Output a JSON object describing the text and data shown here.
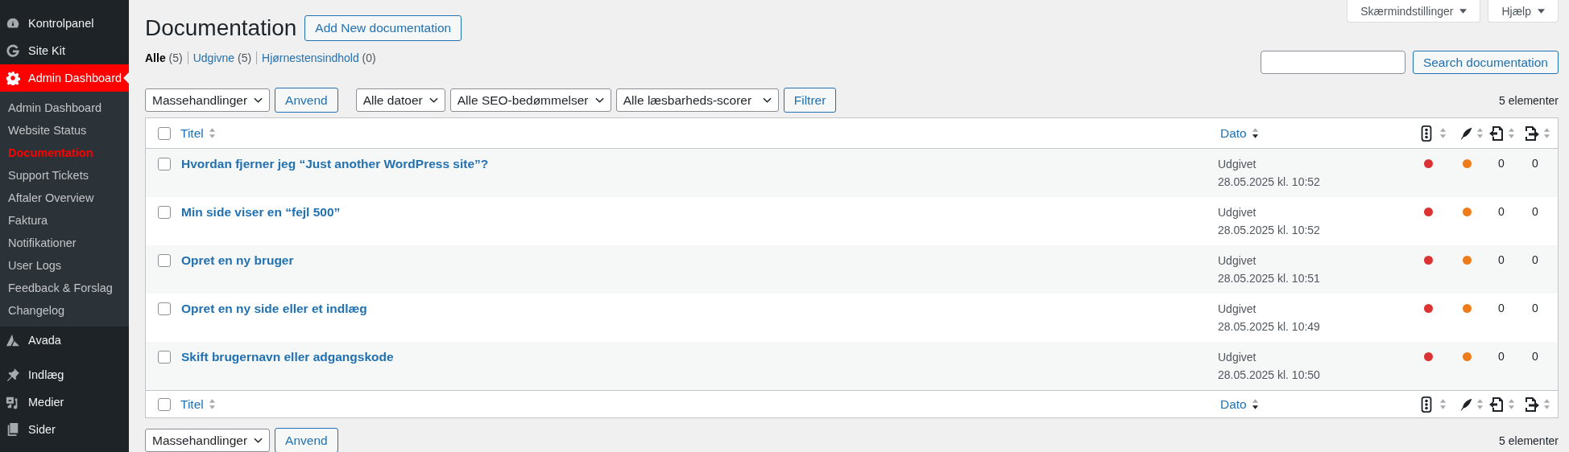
{
  "sidebar": {
    "top_items": [
      {
        "label": "Kontrolpanel",
        "kind": "gauge",
        "selected": false
      },
      {
        "label": "Site Kit",
        "kind": "g",
        "selected": false
      },
      {
        "label": "Admin Dashboard",
        "kind": "gear",
        "selected": true
      }
    ],
    "submenu": [
      {
        "label": "Admin Dashboard",
        "selected": false
      },
      {
        "label": "Website Status",
        "selected": false
      },
      {
        "label": "Documentation",
        "selected": true
      },
      {
        "label": "Support Tickets",
        "selected": false
      },
      {
        "label": "Aftaler Overview",
        "selected": false
      },
      {
        "label": "Faktura",
        "selected": false
      },
      {
        "label": "Notifikationer",
        "selected": false
      },
      {
        "label": "User Logs",
        "selected": false
      },
      {
        "label": "Feedback & Forslag",
        "selected": false
      },
      {
        "label": "Changelog",
        "selected": false
      }
    ],
    "bottom_items": [
      {
        "label": "Avada",
        "kind": "avada",
        "selected": false
      },
      {
        "label": "Indlæg",
        "kind": "pin",
        "selected": false
      },
      {
        "label": "Medier",
        "kind": "media",
        "selected": false
      },
      {
        "label": "Sider",
        "kind": "pages",
        "selected": false
      }
    ]
  },
  "screen_tabs": [
    "Skærmindstillinger",
    "Hjælp"
  ],
  "title": "Documentation",
  "add_button": "Add New documentation",
  "views": [
    {
      "label": "Alle",
      "count": "(5)",
      "selected": true
    },
    {
      "label": "Udgivne",
      "count": "(5)",
      "selected": false
    },
    {
      "label": "Hjørnestensindhold",
      "count": "(0)",
      "selected": false
    }
  ],
  "search": {
    "button": "Search documentation"
  },
  "top_nav": {
    "bulk": "Massehandlinger",
    "apply": "Anvend",
    "filters": [
      "Alle datoer",
      "Alle SEO-bedømmelser",
      "Alle læsbarheds-scorer"
    ],
    "filter_button": "Filtrer",
    "count": "5 elementer"
  },
  "header": {
    "checked": false,
    "columns": [
      {
        "kind": "title",
        "label": "Titel",
        "sorted": false
      },
      {
        "kind": "date",
        "label": "Dato",
        "sorted": true
      },
      {
        "kind": "seo",
        "sorted": false
      },
      {
        "kind": "readability",
        "sorted": false
      },
      {
        "kind": "outgoing",
        "sorted": false
      },
      {
        "kind": "incoming",
        "sorted": false
      }
    ]
  },
  "rows": [
    {
      "title": "Hvordan fjerner jeg “Just another WordPress site”?",
      "status": "Udgivet",
      "date": "28.05.2025 kl. 10:52",
      "seo": {
        "color": "#dc3232"
      },
      "readability": {
        "color": "#ee7c1b"
      },
      "outgoing": "0",
      "incoming": "0",
      "checked": false
    },
    {
      "title": "Min side viser en “fejl 500”",
      "status": "Udgivet",
      "date": "28.05.2025 kl. 10:52",
      "seo": {
        "color": "#dc3232"
      },
      "readability": {
        "color": "#ee7c1b"
      },
      "outgoing": "0",
      "incoming": "0",
      "checked": false
    },
    {
      "title": "Opret en ny bruger",
      "status": "Udgivet",
      "date": "28.05.2025 kl. 10:51",
      "seo": {
        "color": "#dc3232"
      },
      "readability": {
        "color": "#ee7c1b"
      },
      "outgoing": "0",
      "incoming": "0",
      "checked": false
    },
    {
      "title": "Opret en ny side eller et indlæg",
      "status": "Udgivet",
      "date": "28.05.2025 kl. 10:49",
      "seo": {
        "color": "#dc3232"
      },
      "readability": {
        "color": "#ee7c1b"
      },
      "outgoing": "0",
      "incoming": "0",
      "checked": false
    },
    {
      "title": "Skift brugernavn eller adgangskode",
      "status": "Udgivet",
      "date": "28.05.2025 kl. 10:50",
      "seo": {
        "color": "#dc3232"
      },
      "readability": {
        "color": "#ee7c1b"
      },
      "outgoing": "0",
      "incoming": "0",
      "checked": false
    }
  ],
  "footer": {
    "checked": false,
    "columns": [
      {
        "kind": "title",
        "label": "Titel",
        "sorted": false
      },
      {
        "kind": "date",
        "label": "Dato",
        "sorted": true
      },
      {
        "kind": "seo",
        "sorted": false
      },
      {
        "kind": "readability",
        "sorted": false
      },
      {
        "kind": "outgoing",
        "sorted": false
      },
      {
        "kind": "incoming",
        "sorted": false
      }
    ]
  },
  "bottom_nav": {
    "bulk": "Massehandlinger",
    "apply": "Anvend",
    "count": "5 elementer"
  }
}
